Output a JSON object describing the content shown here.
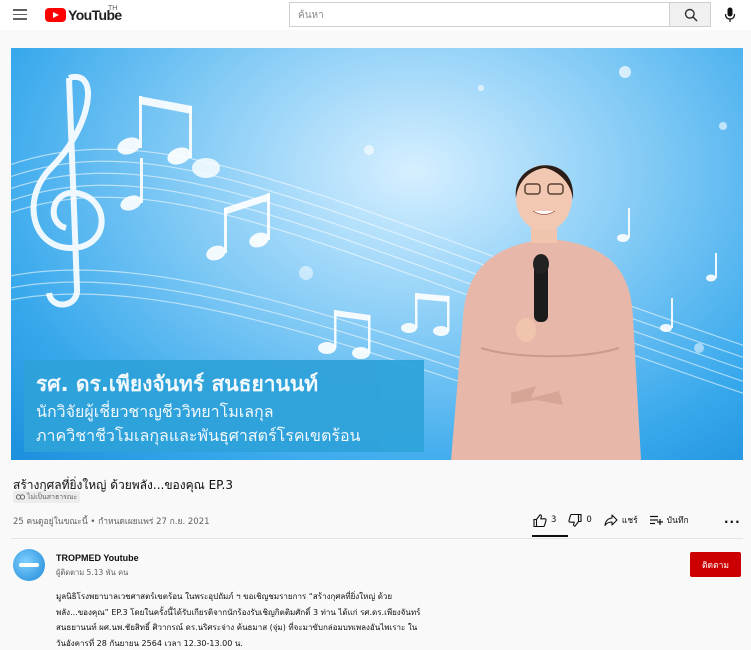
{
  "header": {
    "logo_text": "YouTube",
    "region": "TH",
    "search_placeholder": "ค้นหา"
  },
  "video": {
    "overlay_name": "รศ. ดร.เพียงจันทร์ สนธยานนท์",
    "overlay_line2": "นักวิจัยผู้เชี่ยวชาญชีววิทยาโมเลกุล",
    "overlay_line3": "ภาควิชาชีวโมเลกุลและพันธุศาสตร์โรคเขตร้อน",
    "title": "สร้างกุศลที่ยิ่งใหญ่ ด้วยพลัง...ของคุณ EP.3",
    "badge": "ไม่เป็นสาธารณะ",
    "meta": "25 คนดูอยู่ในขณะนี้ • กำหนดเผยแพร่ 27 ก.ย. 2021"
  },
  "actions": {
    "like_count": "3",
    "dislike_count": "0",
    "share_label": "แชร์",
    "save_label": "บันทึก",
    "more": "..."
  },
  "channel": {
    "name": "TROPMED Youtube",
    "subscribers": "ผู้ติดตาม 5.13 พัน คน",
    "subscribe_label": "ติดตาม"
  },
  "description": {
    "lines": [
      "มูลนิธิโรงพยาบาลเวชศาสตร์เขตร้อน ในพระอุปถัมภ์ ฯ ขอเชิญชมรายการ “สร้างกุศลที่ยิ่งใหญ่ ด้วย",
      "พลัง...ของคุณ” EP.3 โดยในครั้งนี้ได้รับเกียรติจากนักร้องรับเชิญกิตติมศักดิ์ 3 ท่าน ได้แก่ รศ.ดร.เพียงจันทร์",
      "สนธยานนท์ ผศ.นพ.ชัยสิทธิ์ ศิวากรณ์ ดร.นริศระจ่าง ค้นธมาส (จุ่ม) ที่จะมาขับกล่อมบทเพลงอันไพเราะ ใน",
      "วันอังคารที่ 28 กันยายน 2564 เวลา 12.30-13.00 น."
    ]
  },
  "colors": {
    "brand_red": "#ff0000",
    "subscribe_red": "#cc0000",
    "caption_blue": "#2ea2da"
  }
}
